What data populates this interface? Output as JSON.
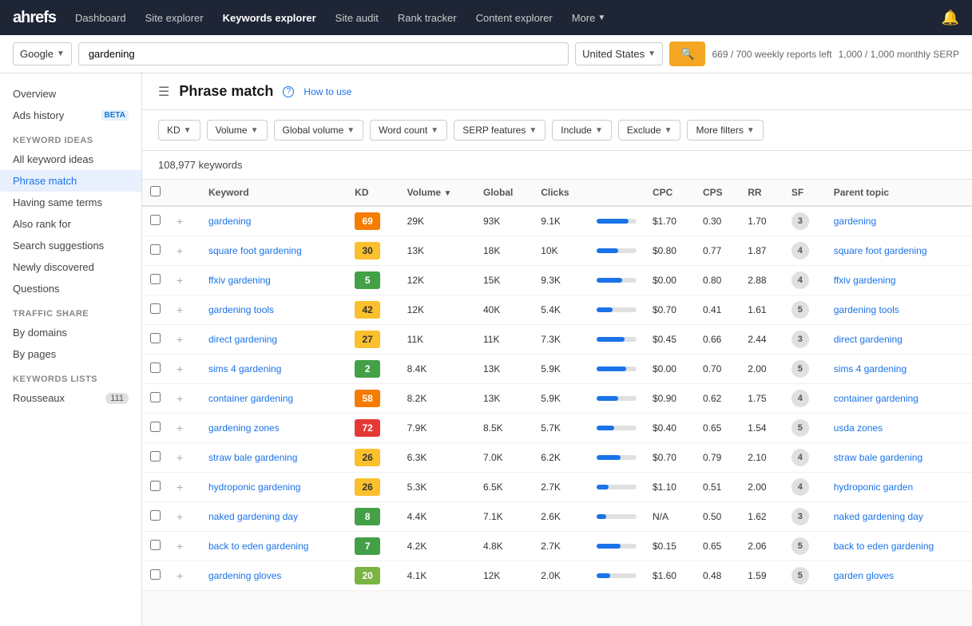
{
  "nav": {
    "logo": "ahrefs",
    "items": [
      {
        "label": "Dashboard",
        "active": false
      },
      {
        "label": "Site explorer",
        "active": false
      },
      {
        "label": "Keywords explorer",
        "active": true
      },
      {
        "label": "Site audit",
        "active": false
      },
      {
        "label": "Rank tracker",
        "active": false
      },
      {
        "label": "Content explorer",
        "active": false
      },
      {
        "label": "More",
        "active": false,
        "dropdown": true
      }
    ]
  },
  "search": {
    "engine": "Google",
    "query": "gardening",
    "country": "United States",
    "reports_left": "669 / 700 weekly reports left",
    "monthly_serp": "1,000 / 1,000 monthly SERP"
  },
  "sidebar": {
    "overview": "Overview",
    "ads_history": "Ads history",
    "ads_history_beta": "BETA",
    "keyword_ideas_title": "Keyword ideas",
    "items": [
      {
        "label": "All keyword ideas",
        "active": false
      },
      {
        "label": "Phrase match",
        "active": true
      },
      {
        "label": "Having same terms",
        "active": false
      },
      {
        "label": "Also rank for",
        "active": false
      },
      {
        "label": "Search suggestions",
        "active": false
      },
      {
        "label": "Newly discovered",
        "active": false
      },
      {
        "label": "Questions",
        "active": false
      }
    ],
    "traffic_share_title": "Traffic share",
    "traffic_items": [
      {
        "label": "By domains",
        "active": false
      },
      {
        "label": "By pages",
        "active": false
      }
    ],
    "keywords_lists_title": "Keywords lists",
    "list_items": [
      {
        "label": "Rousseaux",
        "count": "111"
      }
    ]
  },
  "page": {
    "title": "Phrase match",
    "how_to_use": "How to use",
    "keywords_count": "108,977 keywords"
  },
  "filters": [
    {
      "label": "KD",
      "id": "kd"
    },
    {
      "label": "Volume",
      "id": "volume"
    },
    {
      "label": "Global volume",
      "id": "global-volume"
    },
    {
      "label": "Word count",
      "id": "word-count"
    },
    {
      "label": "SERP features",
      "id": "serp-features"
    },
    {
      "label": "Include",
      "id": "include"
    },
    {
      "label": "Exclude",
      "id": "exclude"
    },
    {
      "label": "More filters",
      "id": "more-filters"
    }
  ],
  "table": {
    "columns": [
      "Keyword",
      "KD",
      "Volume",
      "Global",
      "Clicks",
      "",
      "CPC",
      "CPS",
      "RR",
      "SF",
      "Parent topic"
    ],
    "rows": [
      {
        "keyword": "gardening",
        "kd": 69,
        "kd_class": "kd-orange",
        "volume": "29K",
        "global": "93K",
        "clicks": "9.1K",
        "bar_fill": 80,
        "cpc": "$1.70",
        "cps": "0.30",
        "rr": "1.70",
        "sf": 3,
        "parent_topic": "gardening"
      },
      {
        "keyword": "square foot gardening",
        "kd": 30,
        "kd_class": "kd-yellow",
        "volume": "13K",
        "global": "18K",
        "clicks": "10K",
        "bar_fill": 55,
        "cpc": "$0.80",
        "cps": "0.77",
        "rr": "1.87",
        "sf": 4,
        "parent_topic": "square foot gardening"
      },
      {
        "keyword": "ffxiv gardening",
        "kd": 5,
        "kd_class": "kd-green",
        "volume": "12K",
        "global": "15K",
        "clicks": "9.3K",
        "bar_fill": 65,
        "cpc": "$0.00",
        "cps": "0.80",
        "rr": "2.88",
        "sf": 4,
        "parent_topic": "ffxiv gardening"
      },
      {
        "keyword": "gardening tools",
        "kd": 42,
        "kd_class": "kd-yellow",
        "volume": "12K",
        "global": "40K",
        "clicks": "5.4K",
        "bar_fill": 40,
        "cpc": "$0.70",
        "cps": "0.41",
        "rr": "1.61",
        "sf": 5,
        "parent_topic": "gardening tools"
      },
      {
        "keyword": "direct gardening",
        "kd": 27,
        "kd_class": "kd-yellow",
        "volume": "11K",
        "global": "11K",
        "clicks": "7.3K",
        "bar_fill": 70,
        "cpc": "$0.45",
        "cps": "0.66",
        "rr": "2.44",
        "sf": 3,
        "parent_topic": "direct gardening"
      },
      {
        "keyword": "sims 4 gardening",
        "kd": 2,
        "kd_class": "kd-green",
        "volume": "8.4K",
        "global": "13K",
        "clicks": "5.9K",
        "bar_fill": 75,
        "cpc": "$0.00",
        "cps": "0.70",
        "rr": "2.00",
        "sf": 5,
        "parent_topic": "sims 4 gardening"
      },
      {
        "keyword": "container gardening",
        "kd": 58,
        "kd_class": "kd-orange",
        "volume": "8.2K",
        "global": "13K",
        "clicks": "5.9K",
        "bar_fill": 55,
        "cpc": "$0.90",
        "cps": "0.62",
        "rr": "1.75",
        "sf": 4,
        "parent_topic": "container gardening"
      },
      {
        "keyword": "gardening zones",
        "kd": 72,
        "kd_class": "kd-red",
        "volume": "7.9K",
        "global": "8.5K",
        "clicks": "5.7K",
        "bar_fill": 45,
        "cpc": "$0.40",
        "cps": "0.65",
        "rr": "1.54",
        "sf": 5,
        "parent_topic": "usda zones"
      },
      {
        "keyword": "straw bale gardening",
        "kd": 26,
        "kd_class": "kd-yellow",
        "volume": "6.3K",
        "global": "7.0K",
        "clicks": "6.2K",
        "bar_fill": 60,
        "cpc": "$0.70",
        "cps": "0.79",
        "rr": "2.10",
        "sf": 4,
        "parent_topic": "straw bale gardening"
      },
      {
        "keyword": "hydroponic gardening",
        "kd": 26,
        "kd_class": "kd-yellow",
        "volume": "5.3K",
        "global": "6.5K",
        "clicks": "2.7K",
        "bar_fill": 30,
        "cpc": "$1.10",
        "cps": "0.51",
        "rr": "2.00",
        "sf": 4,
        "parent_topic": "hydroponic garden"
      },
      {
        "keyword": "naked gardening day",
        "kd": 8,
        "kd_class": "kd-green",
        "volume": "4.4K",
        "global": "7.1K",
        "clicks": "2.6K",
        "bar_fill": 25,
        "cpc": "N/A",
        "cps": "0.50",
        "rr": "1.62",
        "sf": 3,
        "parent_topic": "naked gardening day"
      },
      {
        "keyword": "back to eden gardening",
        "kd": 7,
        "kd_class": "kd-green",
        "volume": "4.2K",
        "global": "4.8K",
        "clicks": "2.7K",
        "bar_fill": 60,
        "cpc": "$0.15",
        "cps": "0.65",
        "rr": "2.06",
        "sf": 5,
        "parent_topic": "back to eden gardening"
      },
      {
        "keyword": "gardening gloves",
        "kd": 20,
        "kd_class": "kd-light-green",
        "volume": "4.1K",
        "global": "12K",
        "clicks": "2.0K",
        "bar_fill": 35,
        "cpc": "$1.60",
        "cps": "0.48",
        "rr": "1.59",
        "sf": 5,
        "parent_topic": "garden gloves"
      }
    ]
  }
}
